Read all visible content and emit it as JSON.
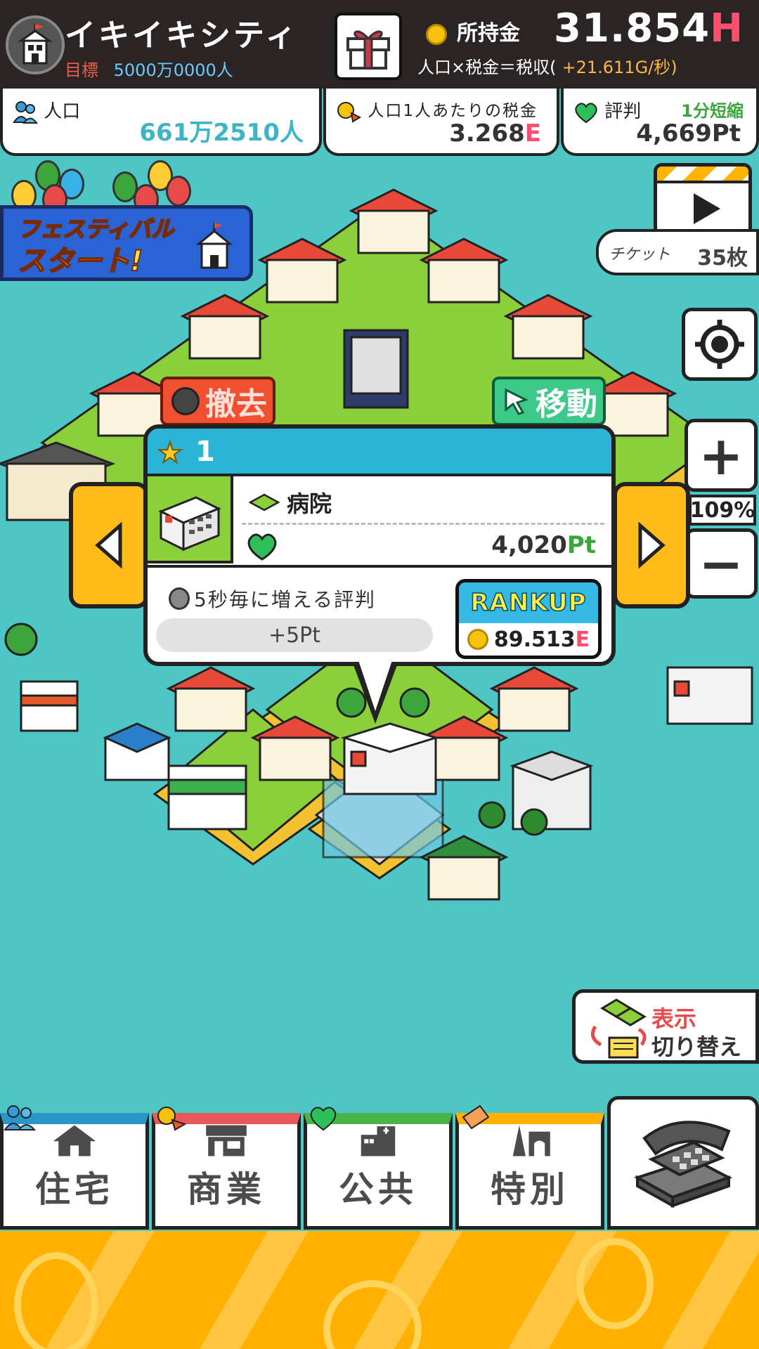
{
  "header": {
    "city_name": "イキイキシティ",
    "goal_label": "目標",
    "goal_value": "5000万0000人",
    "money_label": "所持金",
    "money_value": "31.854",
    "money_unit": "H",
    "formula": "人口×税金＝税収(",
    "income_rate": "+21.611G/秒)"
  },
  "stats": {
    "population_label": "人口",
    "population_value": "661万2510人",
    "tax_label": "人口1人あたりの税金",
    "tax_value": "3.268",
    "tax_unit": "E",
    "reputation_label": "評判",
    "reputation_shorten": "1分短縮",
    "reputation_value": "4,669Pt"
  },
  "festival": {
    "line1": "フェスティバル",
    "line2": "スタート!"
  },
  "ticket": {
    "label": "チケット",
    "count": "35枚"
  },
  "zoom": {
    "level": "109%",
    "plus": "+",
    "minus": "−"
  },
  "actions": {
    "remove": "撤去",
    "move": "移動"
  },
  "popup": {
    "level": "1",
    "building_name": "病院",
    "reputation_value": "4,020",
    "reputation_unit": "Pt",
    "interval_text": "5秒毎に増える評判",
    "bonus": "+5Pt",
    "rankup_label": "RANKUP",
    "rankup_cost": "89.513",
    "rankup_unit": "E"
  },
  "display_switch": {
    "line1": "表示",
    "line2": "切り替え"
  },
  "tabs": [
    {
      "label": "住宅",
      "icon": "house-icon"
    },
    {
      "label": "商業",
      "icon": "shop-icon"
    },
    {
      "label": "公共",
      "icon": "public-building-icon"
    },
    {
      "label": "特別",
      "icon": "tower-icon"
    }
  ],
  "colors": {
    "background": "#4ec6c6",
    "header": "#2a2424",
    "accent_yellow": "#ffbb1a",
    "popup_header": "#2bb4d6",
    "remove": "#f05030",
    "move": "#3cc98a"
  }
}
